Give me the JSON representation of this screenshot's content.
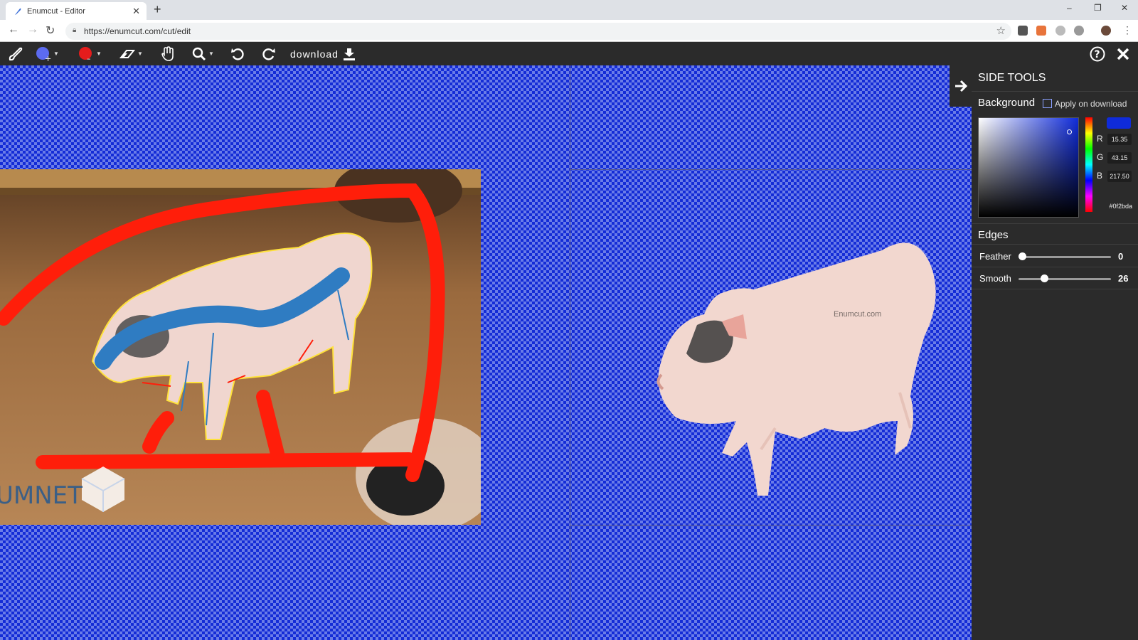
{
  "browser": {
    "tab_title": "Enumcut - Editor",
    "tab_close": "✕",
    "new_tab": "+",
    "url": "https://enumcut.com/cut/edit",
    "window_controls": [
      "–",
      "❐",
      "✕"
    ]
  },
  "toolbar": {
    "tools": [
      "brush-icon",
      "add-brush-icon",
      "color-brush-icon",
      "eraser-icon",
      "hand-icon",
      "zoom-icon",
      "undo-icon",
      "redo-icon"
    ],
    "download_label": "download",
    "accent_add": "#5c6bf0",
    "accent_remove": "#e51c1c"
  },
  "canvas": {
    "background_color": "#0f2bda",
    "result_watermark": "Enumcut.com",
    "source_watermark": "UMNET"
  },
  "side_panel": {
    "title": "SIDE TOOLS",
    "background_label": "Background",
    "apply_on_download_label": "Apply on download",
    "apply_on_download_checked": false,
    "color": {
      "r_label": "R",
      "r": "15.35",
      "g_label": "G",
      "g": "43.15",
      "b_label": "B",
      "b": "217.50",
      "hex": "#0f2bda"
    },
    "edges_label": "Edges",
    "feather_label": "Feather",
    "feather_value": "0",
    "feather_fraction": 0.0,
    "smooth_label": "Smooth",
    "smooth_value": "26",
    "smooth_fraction": 0.26
  }
}
